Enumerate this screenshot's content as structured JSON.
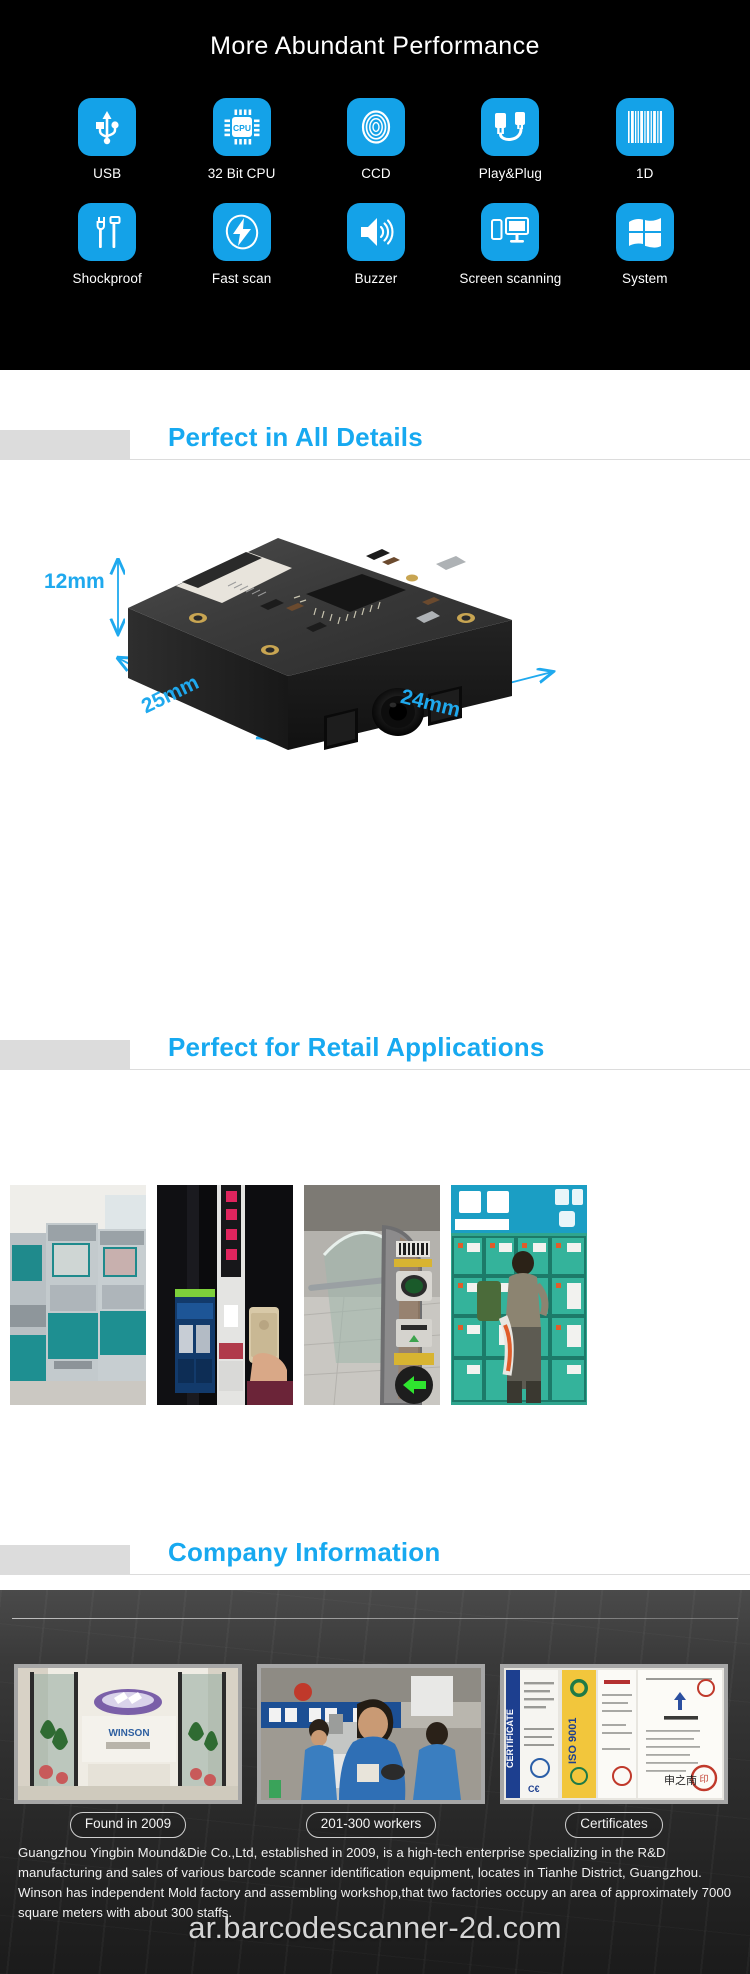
{
  "features": {
    "title": "More Abundant Performance",
    "items": [
      {
        "icon": "usb-icon",
        "label": "USB"
      },
      {
        "icon": "cpu-chip-icon",
        "label": "32 Bit CPU"
      },
      {
        "icon": "ccd-sensor-icon",
        "label": "CCD"
      },
      {
        "icon": "plug-and-play-icon",
        "label": "Play&Plug"
      },
      {
        "icon": "barcode-1d-icon",
        "label": "1D"
      },
      {
        "icon": "tools-icon",
        "label": "Shockproof"
      },
      {
        "icon": "lightning-bolt-icon",
        "label": "Fast scan"
      },
      {
        "icon": "speaker-icon",
        "label": "Buzzer"
      },
      {
        "icon": "screen-scanning-icon",
        "label": "Screen scanning"
      },
      {
        "icon": "windows-logo-icon",
        "label": "System"
      }
    ]
  },
  "sections": {
    "details": {
      "title": "Perfect in All Details"
    },
    "retail": {
      "title": "Perfect for Retail Applications"
    },
    "company_head": {
      "title": "Company Information"
    }
  },
  "product_dimensions": {
    "height": "12mm",
    "depth": "25mm",
    "width": "24mm"
  },
  "retail_photos": [
    {
      "name": "bank-self-service-kiosks"
    },
    {
      "name": "ticket-vending-machine-phone-scan"
    },
    {
      "name": "subway-turnstile-gate"
    },
    {
      "name": "storage-locker-station"
    }
  ],
  "company": {
    "photos": [
      {
        "name": "company-entrance-lobby",
        "caption": "Found in 2009"
      },
      {
        "name": "factory-workshop-workers",
        "caption": "201-300 workers"
      },
      {
        "name": "certificates-display",
        "caption": "Certificates"
      }
    ],
    "description": "Guangzhou Yingbin Mound&Die Co.,Ltd, established in 2009, is a high-tech enterprise specializing in the R&D manufacturing and sales of various barcode scanner identification equipment, locates in Tianhe District, Guangzhou. Winson has independent Mold factory and assembling workshop,that two factories occupy an area of approximately 7000 square meters with about 300 staffs."
  },
  "watermark": {
    "text": "ar.barcodescanner-2d.com"
  },
  "colors": {
    "accent_blue": "#14A2E8",
    "heading_blue": "#17A9F0",
    "grey_block": "#dcdcdc",
    "black_bg": "#000000"
  }
}
